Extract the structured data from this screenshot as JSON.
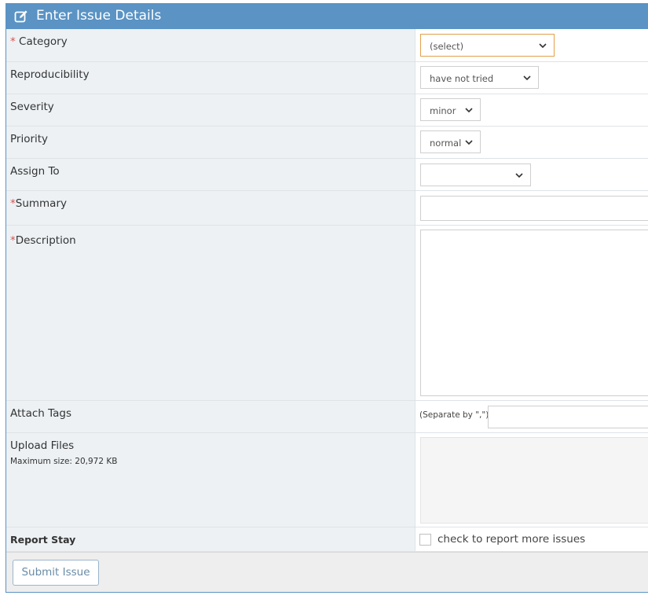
{
  "header": {
    "title": "Enter Issue Details",
    "icon": "edit-icon"
  },
  "fields": {
    "category": {
      "required_mark": "* ",
      "label": "Category",
      "value": "(select)"
    },
    "reproducibility": {
      "label": "Reproducibility",
      "value": "have not tried"
    },
    "severity": {
      "label": "Severity",
      "value": "minor"
    },
    "priority": {
      "label": "Priority",
      "value": "normal"
    },
    "assign_to": {
      "label": "Assign To",
      "value": ""
    },
    "summary": {
      "required_mark": "*",
      "label": "Summary",
      "value": ""
    },
    "description": {
      "required_mark": "*",
      "label": "Description",
      "value": ""
    },
    "attach_tags": {
      "label": "Attach Tags",
      "hint": "(Separate by \",\")",
      "value": ""
    },
    "upload_files": {
      "label": "Upload Files",
      "sub": "Maximum size: 20,972 KB"
    },
    "report_stay": {
      "label": "Report Stay",
      "checkbox_label": "check to report more issues",
      "checked": false
    }
  },
  "footer": {
    "submit_label": "Submit Issue"
  },
  "colors": {
    "header_bg": "#5a93c4",
    "label_bg": "#edf1f4",
    "required": "#d9534f",
    "focus_border": "#e3a04a"
  }
}
